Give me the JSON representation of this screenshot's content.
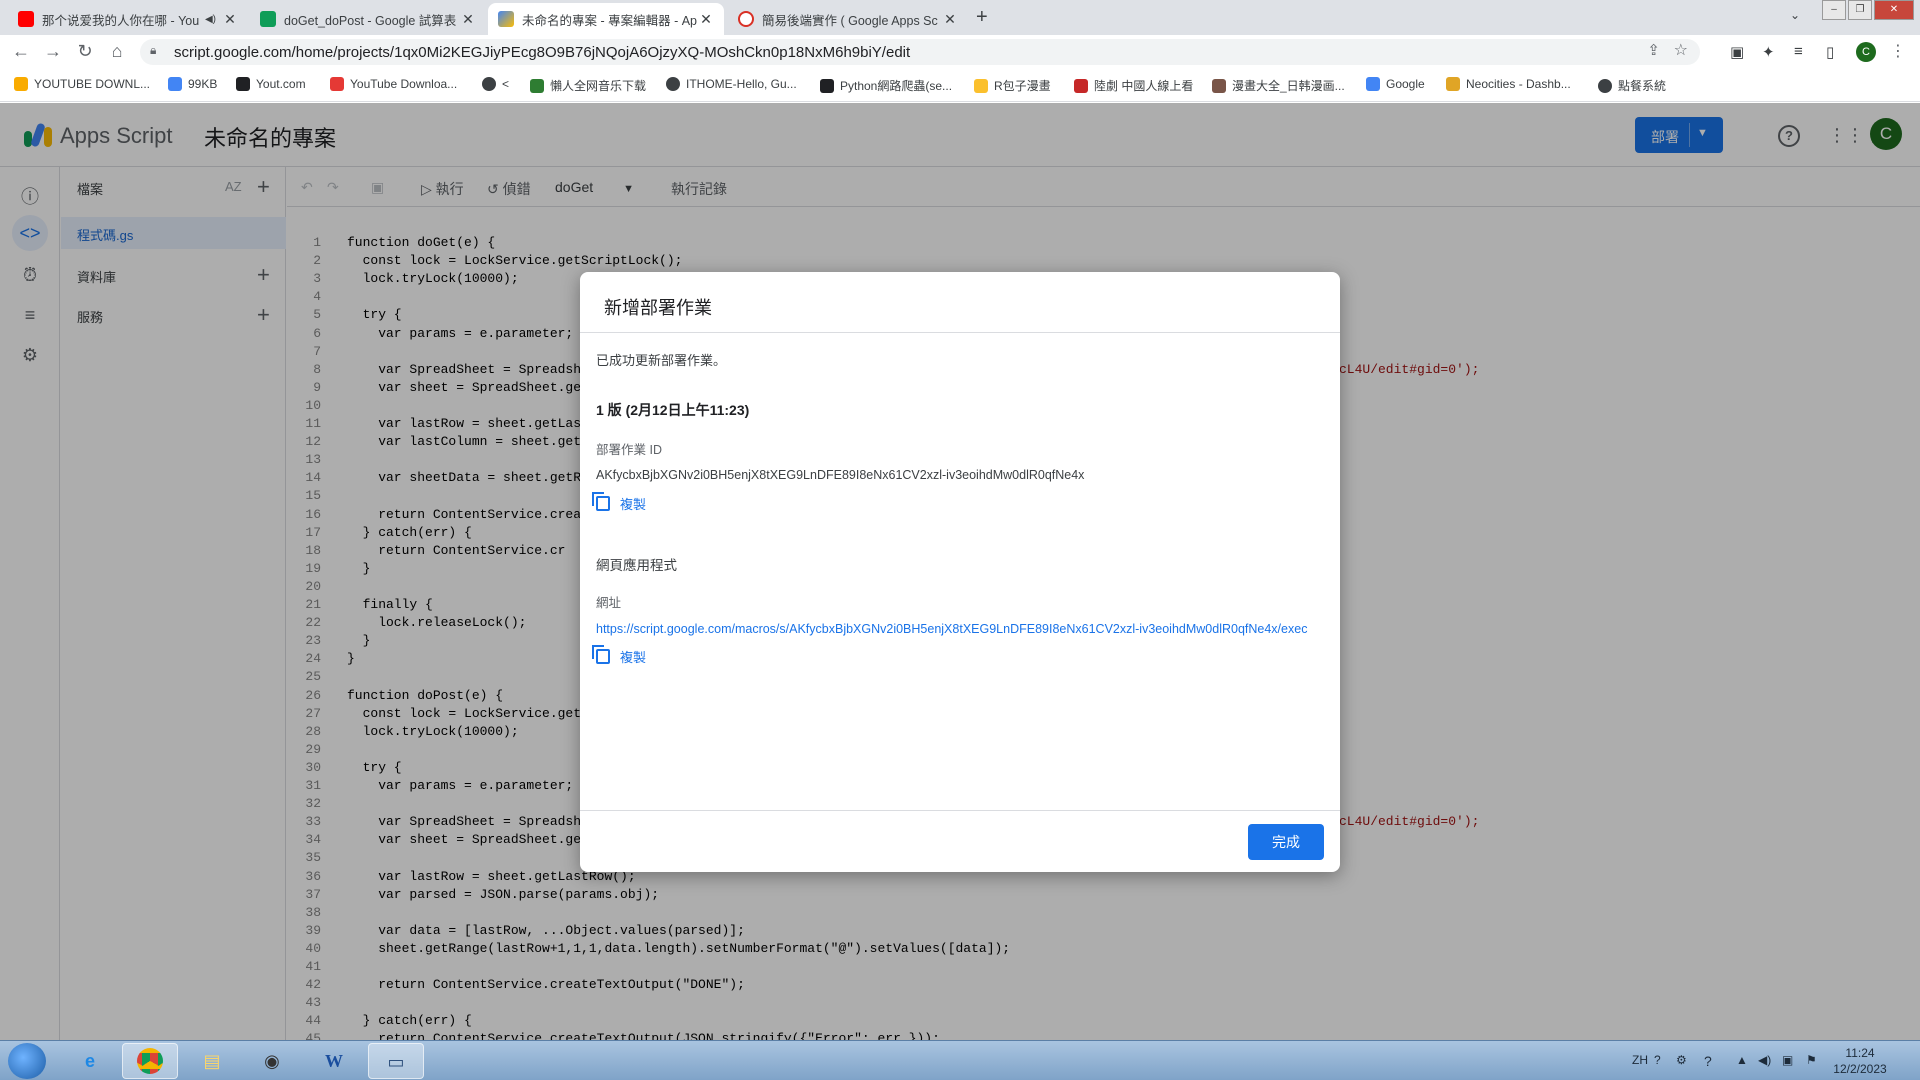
{
  "browser": {
    "tabs": [
      {
        "title": "那个说爱我的人你在哪 - You",
        "has_audio": "◀)"
      },
      {
        "title": "doGet_doPost - Google 試算表"
      },
      {
        "title": "未命名的專案 - 專案編輯器 - Ap"
      },
      {
        "title": "簡易後端實作 ( Google Apps Sc"
      }
    ],
    "url": "script.google.com/home/projects/1qx0Mi2KEGJiyPEcg8O9B76jNQojA6OjzyXQ-MOshCkn0p18NxM6h9biY/edit",
    "profile_initial": "C",
    "bookmarks": [
      "YOUTUBE DOWNL...",
      "99KB",
      "Yout.com",
      "YouTube Downloa...",
      "<",
      "懶人全网音乐下载",
      "ITHOME-Hello, Gu...",
      "Python網路爬蟲(se...",
      "R包子漫畫",
      "陸劇 中國人線上看",
      "漫畫大全_日韩漫画...",
      "Google",
      "Neocities - Dashb...",
      "點餐系統"
    ]
  },
  "app": {
    "name": "Apps Script",
    "project_name": "未命名的專案",
    "deploy_label": "部署",
    "avatar_initial": "C"
  },
  "files_panel": {
    "files_header": "檔案",
    "sort_label": "AZ",
    "active_file": "程式碼.gs",
    "libraries_header": "資料庫",
    "services_header": "服務"
  },
  "toolbar": {
    "run_label": "執行",
    "debug_label": "偵錯",
    "function_select": "doGet",
    "log_label": "執行記錄"
  },
  "code_lines": [
    {
      "n": "1",
      "t": "function doGet(e) {"
    },
    {
      "n": "2",
      "t": "  const lock = LockService.getScriptLock();"
    },
    {
      "n": "3",
      "t": "  lock.tryLock(10000);"
    },
    {
      "n": "4",
      "t": ""
    },
    {
      "n": "5",
      "t": "  try {"
    },
    {
      "n": "6",
      "t": "    var params = e.parameter;"
    },
    {
      "n": "7",
      "t": ""
    },
    {
      "n": "8",
      "t": "    var SpreadSheet = Spreadsh"
    },
    {
      "n": "9",
      "t": "    var sheet = SpreadSheet.ge"
    },
    {
      "n": "10",
      "t": ""
    },
    {
      "n": "11",
      "t": "    var lastRow = sheet.getLas"
    },
    {
      "n": "12",
      "t": "    var lastColumn = sheet.get"
    },
    {
      "n": "13",
      "t": ""
    },
    {
      "n": "14",
      "t": "    var sheetData = sheet.getR"
    },
    {
      "n": "15",
      "t": ""
    },
    {
      "n": "16",
      "t": "    return ContentService.crea"
    },
    {
      "n": "17",
      "t": "  } catch(err) {"
    },
    {
      "n": "18",
      "t": "    return ContentService.cr"
    },
    {
      "n": "19",
      "t": "  }"
    },
    {
      "n": "20",
      "t": ""
    },
    {
      "n": "21",
      "t": "  finally {"
    },
    {
      "n": "22",
      "t": "    lock.releaseLock();"
    },
    {
      "n": "23",
      "t": "  }"
    },
    {
      "n": "24",
      "t": "}"
    },
    {
      "n": "25",
      "t": ""
    },
    {
      "n": "26",
      "t": "function doPost(e) {"
    },
    {
      "n": "27",
      "t": "  const lock = LockService.get"
    },
    {
      "n": "28",
      "t": "  lock.tryLock(10000);"
    },
    {
      "n": "29",
      "t": ""
    },
    {
      "n": "30",
      "t": "  try {"
    },
    {
      "n": "31",
      "t": "    var params = e.parameter;"
    },
    {
      "n": "32",
      "t": ""
    },
    {
      "n": "33",
      "t": "    var SpreadSheet = Spreadsh"
    },
    {
      "n": "34",
      "t": "    var sheet = SpreadSheet.ge"
    },
    {
      "n": "35",
      "t": ""
    },
    {
      "n": "36",
      "t": "    var lastRow = sheet.getLastRow();"
    },
    {
      "n": "37",
      "t": "    var parsed = JSON.parse(params.obj);"
    },
    {
      "n": "38",
      "t": ""
    },
    {
      "n": "39",
      "t": "    var data = [lastRow, ...Object.values(parsed)];"
    },
    {
      "n": "40",
      "t": "    sheet.getRange(lastRow+1,1,1,data.length).setNumberFormat(\"@\").setValues([data]);"
    },
    {
      "n": "41",
      "t": ""
    },
    {
      "n": "42",
      "t": "    return ContentService.createTextOutput(\"DONE\");"
    },
    {
      "n": "43",
      "t": ""
    },
    {
      "n": "44",
      "t": "  } catch(err) {"
    },
    {
      "n": "45",
      "t": "    return ContentService.createTextOutput(JSON.stringify({\"Error\": err }));"
    }
  ],
  "code_tail": "cL4U/edit#gid=0');",
  "dialog": {
    "title": "新增部署作業",
    "success_message": "已成功更新部署作業。",
    "version_line": "1 版 (2月12日上午11:23)",
    "deployment_id_label": "部署作業 ID",
    "deployment_id": "AKfycbxBjbXGNv2i0BH5enjX8tXEG9LnDFE89I8eNx61CV2xzl-iv3eoihdMw0dlR0qfNe4x",
    "copy_label": "複製",
    "web_app_label": "網頁應用程式",
    "url_label": "網址",
    "url": "https://script.google.com/macros/s/AKfycbxBjbXGNv2i0BH5enjX8tXEG9LnDFE89I8eNx61CV2xzl-iv3eoihdMw0dlR0qfNe4x/exec",
    "done_label": "完成"
  },
  "taskbar": {
    "lang": "ZH",
    "time": "11:24",
    "date": "12/2/2023"
  },
  "colors": {
    "accent": "#1a73e8",
    "avatar": "#1e6b1e"
  }
}
